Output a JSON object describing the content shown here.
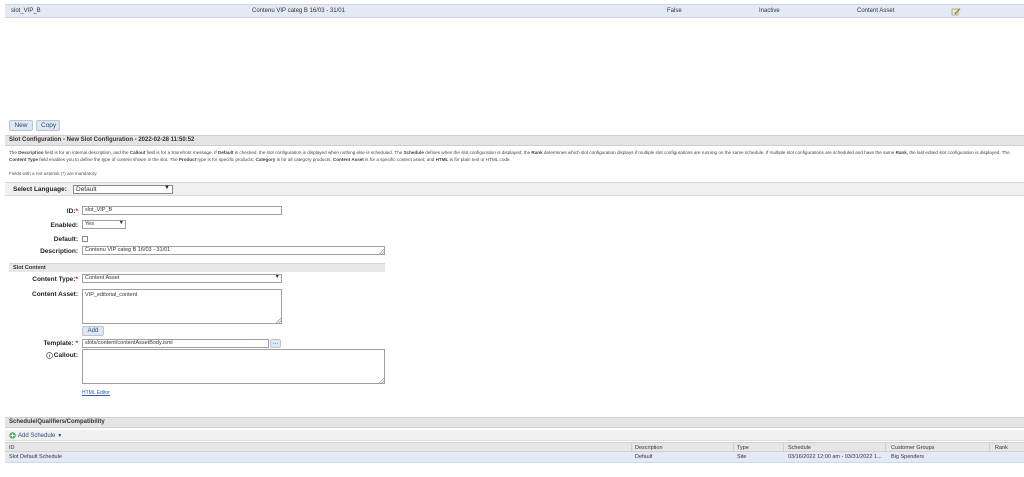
{
  "top_row": {
    "id": "slot_VIP_B",
    "description": "Contenu VIP categ B 16/03 - 31/01",
    "default": "False",
    "status": "Inactive",
    "content_type": "Content Asset"
  },
  "buttons": {
    "new": "New",
    "copy": "Copy"
  },
  "config_header": "Slot Configuration - New Slot Configuration - 2022-02-28 11:50:52",
  "help_text": {
    "p1": "The ",
    "b1": "Description",
    "p2": " field is for an internal description, and the ",
    "b2": "Callout",
    "p3": " field is for a Storefront message. If ",
    "b3": "Default",
    "p4": " is checked, the slot configuration is displayed when nothing else is scheduled. The ",
    "b4": "Schedule",
    "p5": " defines when the slot configuration is displayed; the ",
    "b5": "Rank",
    "p6": " determines which slot configuration displays if multiple slot configurations are running on the same schedule. If multiple slot configurations are scheduled and have the same ",
    "b6": "Rank",
    "p7": ", the last edited slot configuration is displayed. The ",
    "b7": "Content Type",
    "p8": " field enables you to define the type of content shown in the slot. The ",
    "b8": "Product",
    "p9": " type is for specific products; ",
    "b9": "Category",
    "p10": " is for all category products; ",
    "b10": "Content Asset",
    "p11": " is for a specific content asset; and ",
    "b11": "HTML",
    "p12": " is for plain text or HTML code."
  },
  "mandatory_note": "Fields with a red asterisk (*) are mandatory.",
  "language": {
    "label": "Select Language:",
    "value": "Default"
  },
  "form": {
    "id_label": "ID:",
    "id_value": "slot_VIP_B",
    "enabled_label": "Enabled:",
    "enabled_value": "Yes",
    "default_label": "Default:",
    "description_label": "Description:",
    "description_value": "Contenu VIP categ B 16/03 - 31/01",
    "slot_content_header": "Slot Content",
    "content_type_label": "Content Type:",
    "content_type_value": "Content Asset",
    "content_asset_label": "Content Asset:",
    "content_asset_value": "VIP_editorial_content",
    "add_button": "Add",
    "template_label": "Template:",
    "template_value": "slots/content/contentAssetBody.isml",
    "template_browse": "...",
    "callout_label": "Callout:",
    "html_editor_link": "HTML Editor",
    "asterisk": "*"
  },
  "schedule": {
    "header": "Schedule/Qualifiers/Compatibility",
    "add_label": "Add Schedule",
    "columns": [
      "ID",
      "Description",
      "Type",
      "Schedule",
      "Customer Groups",
      "Rank"
    ],
    "rows": [
      {
        "id": "Slot Default Schedule",
        "description": "Default",
        "type": "Site",
        "schedule": "03/16/2022 12:00 am - 03/31/2022 1...",
        "customer_groups": "Big Spenders",
        "rank": ""
      }
    ]
  }
}
